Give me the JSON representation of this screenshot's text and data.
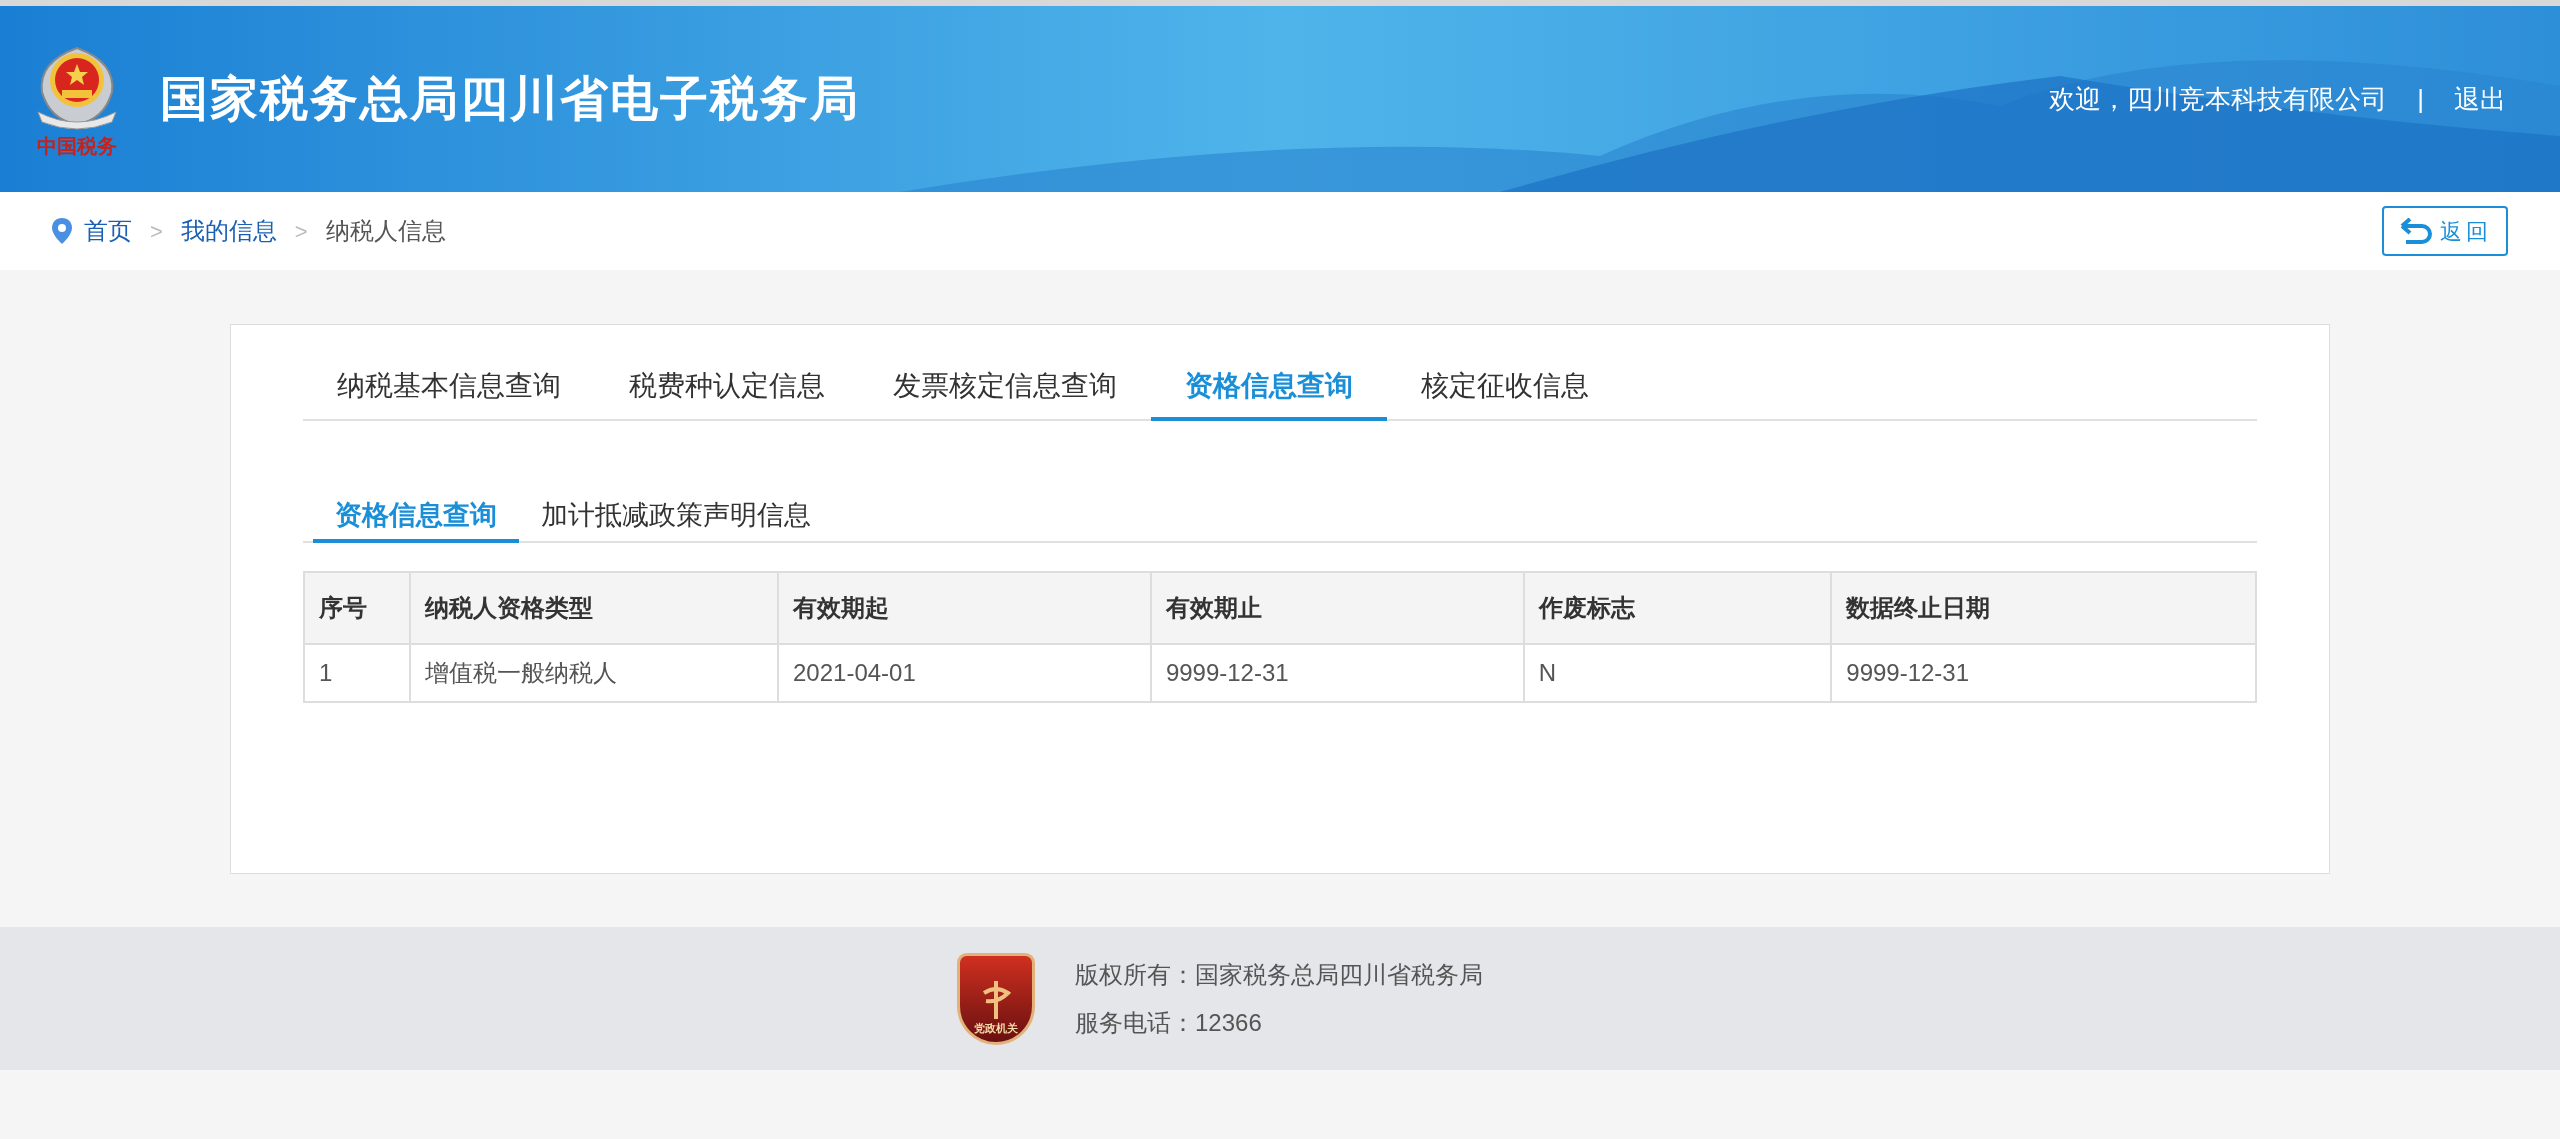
{
  "header": {
    "logo_caption": "中国税务",
    "title": "国家税务总局四川省电子税务局",
    "welcome": "欢迎，四川竞本科技有限公司",
    "separator": "|",
    "logout": "退出"
  },
  "breadcrumb": {
    "items": [
      {
        "label": "首页",
        "link": true
      },
      {
        "label": "我的信息",
        "link": true
      },
      {
        "label": "纳税人信息",
        "link": false
      }
    ],
    "separator": ">",
    "back_button": "返回"
  },
  "tabs": [
    {
      "label": "纳税基本信息查询",
      "selected": false
    },
    {
      "label": "税费种认定信息",
      "selected": false
    },
    {
      "label": "发票核定信息查询",
      "selected": false
    },
    {
      "label": "资格信息查询",
      "selected": true
    },
    {
      "label": "核定征收信息",
      "selected": false
    }
  ],
  "subtabs": [
    {
      "label": "资格信息查询",
      "selected": true
    },
    {
      "label": "加计抵减政策声明信息",
      "selected": false
    }
  ],
  "table": {
    "columns": [
      "序号",
      "纳税人资格类型",
      "有效期起",
      "有效期止",
      "作废标志",
      "数据终止日期"
    ],
    "rows": [
      [
        "1",
        "增值税一般纳税人",
        "2021-04-01",
        "9999-12-31",
        "N",
        "9999-12-31"
      ]
    ]
  },
  "footer": {
    "badge_text": "党政机关",
    "copyright": "版权所有：国家税务总局四川省税务局",
    "phone": "服务电话：12366"
  }
}
